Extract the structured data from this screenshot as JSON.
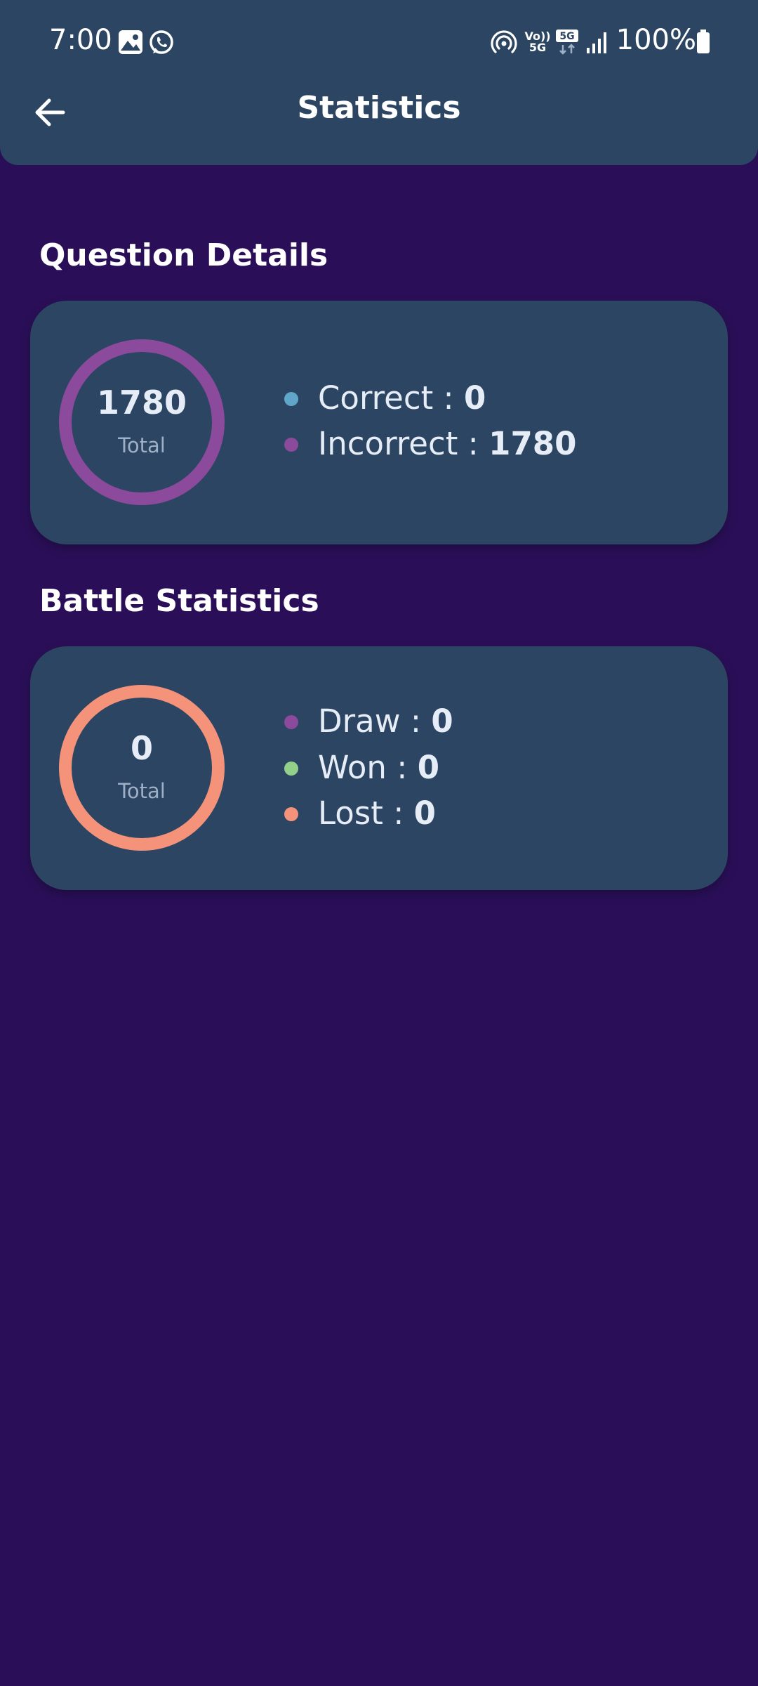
{
  "status_bar": {
    "time": "7:00",
    "battery": "100%",
    "icons": [
      "gallery-icon",
      "whatsapp-icon",
      "hotspot-icon",
      "volte-icon",
      "5g-icon",
      "signal-icon",
      "battery-icon"
    ],
    "volte_label": "Vo))\n5G",
    "network_label": "5G"
  },
  "appbar": {
    "title": "Statistics",
    "back_icon": "arrow-left-icon"
  },
  "question_details": {
    "heading": "Question Details",
    "total": "1780",
    "total_label": "Total",
    "ring_color": "#8b4a9c",
    "items": [
      {
        "label": "Correct : ",
        "value": "0",
        "color": "#5fa6c9"
      },
      {
        "label": "Incorrect : ",
        "value": "1780",
        "color": "#8b4a9c"
      }
    ]
  },
  "battle_statistics": {
    "heading": "Battle Statistics",
    "total": "0",
    "total_label": "Total",
    "ring_color": "#f4927a",
    "items": [
      {
        "label": "Draw : ",
        "value": "0",
        "color": "#8b4a9c"
      },
      {
        "label": "Won : ",
        "value": "0",
        "color": "#93d08a"
      },
      {
        "label": "Lost : ",
        "value": "0",
        "color": "#f4927a"
      }
    ]
  }
}
